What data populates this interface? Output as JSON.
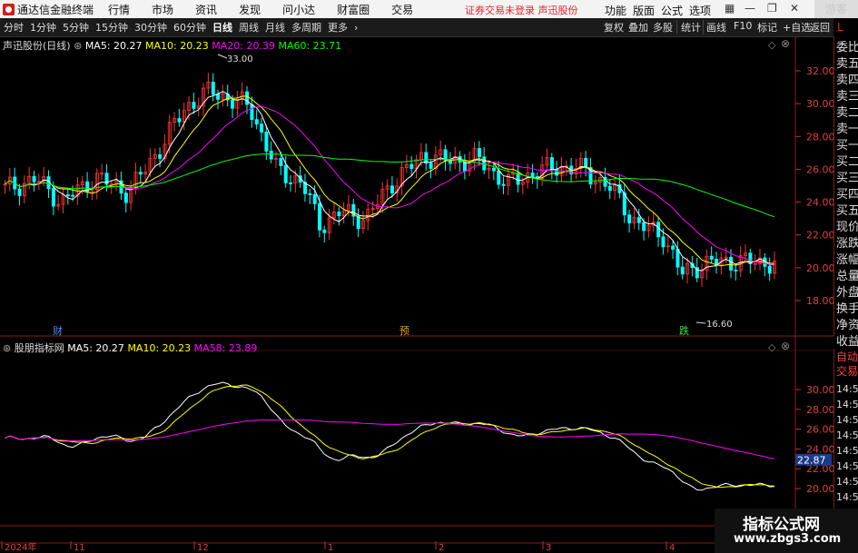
{
  "app": {
    "title": "通达信金融终端",
    "menus": [
      "行情",
      "市场",
      "资讯",
      "发现",
      "问小达",
      "财富圈",
      "交易"
    ],
    "notice": "证券交易未登录  声迅股份",
    "right_menus": [
      "功能",
      "版面",
      "公式",
      "选项"
    ],
    "guest": "游客"
  },
  "toolbar": {
    "tabs": [
      "分时",
      "1分钟",
      "5分钟",
      "15分钟",
      "30分钟",
      "60分钟",
      "日线",
      "周线",
      "月线",
      "多周期",
      "更多"
    ],
    "active": "日线",
    "buttons": [
      "复权",
      "叠加",
      "多股",
      "统计",
      "画线",
      "F10",
      "标记",
      "+自选",
      "返回"
    ],
    "L": "L"
  },
  "main_legend": {
    "name": "声迅股份(日线)",
    "ma5": "MA5: 20.27",
    "ma10": "MA10: 20.23",
    "ma20": "MA20: 20.39",
    "ma60": "MA60: 23.71"
  },
  "sub_legend": {
    "name": "股朋指标网",
    "ma5": "MA5: 20.27",
    "ma10": "MA10: 20.23",
    "ma58": "MA58: 23.89"
  },
  "annotations": {
    "high": "33.00",
    "low": "16.60",
    "event1": "财",
    "event2": "预",
    "event3": "跌"
  },
  "price_axis": [
    "32.00",
    "30.00",
    "28.00",
    "26.00",
    "24.00",
    "22.00",
    "20.00",
    "18.00"
  ],
  "sub_axis": [
    "30.00",
    "28.00",
    "26.00",
    "24.00",
    "22.00",
    "20.00"
  ],
  "sub_highlight": "22.87",
  "right_panel": {
    "top": [
      "委比",
      "卖五",
      "卖四",
      "卖三",
      "卖二",
      "卖一",
      "买一",
      "买二",
      "买三",
      "买四",
      "买五",
      "现价",
      "涨跌",
      "涨幅",
      "总量",
      "外盘",
      "换手",
      "净资",
      "收益"
    ],
    "bottom_head": [
      "自动",
      "交易"
    ],
    "times": [
      "14:56",
      "14:56",
      "14:56",
      "14:56",
      "14:56",
      "14:56",
      "14:56",
      "14:56",
      "14:56"
    ]
  },
  "date_axis": [
    "2024年",
    "11",
    "12",
    "1",
    "2",
    "3",
    "4"
  ],
  "watermark": {
    "line1": "指标公式网",
    "line2": "www.zbgs3.com"
  },
  "colors": {
    "up": "#ff3232",
    "down": "#00ffff",
    "ma5": "#ffffff",
    "ma10": "#ffff00",
    "ma20": "#ff00ff",
    "ma60": "#00ff00"
  }
}
